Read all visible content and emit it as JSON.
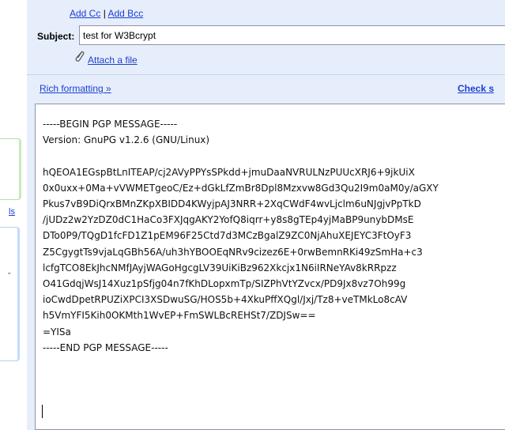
{
  "compose": {
    "add_cc": "Add Cc",
    "separator": "|",
    "add_bcc": "Add Bcc",
    "subject_label": "Subject:",
    "subject_value": "test for W3Bcrypt",
    "attach_label": "Attach a file",
    "rich_formatting": "Rich formatting »",
    "check_spelling": "Check s"
  },
  "sidebar": {
    "partial_link": "ls",
    "partial_mark": "ˇ"
  },
  "message": {
    "body": "-----BEGIN PGP MESSAGE-----\nVersion: GnuPG v1.2.6 (GNU/Linux)\n\nhQEOA1EGspBtLnITEAP/cj2AVyPPYsSPkdd+jmuDaaNVRULNzPUUcXRJ6+9jkUiX\n0x0uxx+0Ma+vVWMETgeoC/Ez+dGkLfZmBr8Dpl8Mzxvw8Gd3Qu2I9m0aM0y/aGXY\nPkus7vB9DiQrxBMnZKpXBIDD4KWyjpAJ3NRR+2XqCWdF4wvLjclm6uNJgjvPpTkD\n/jUDz2w2YzDZ0dC1HaCo3FXJqgAKY2YofQ8iqrr+y8s8gTEp4yjMaBP9unybDMsE\nDTo0P9/TQgD1fcFD1Z1pEM96F25Ctd7d3MCzBgalZ9ZC0NjAhuXEJEYC3FtOyF3\nZ5CgygtTs9vjaLqGBh56A/uh3hYBOOEqNRv9cizez6E+0rwBemnRKi49zSmHa+c3\nlcfgTCO8EkJhcNMfJAyjWAGoHgcgLV39UiKiBz962Xkcjx1N6iIRNeYAv8kRRpzz\nO41GdqjWsJ14Xuz1pSfjg04n7fKhDLopxmTp/SIZPhVtYZvcx/PD9Jx8vz7Oh99g\nioCwdDpetRPUZiXPCI3XSDwuSG/HOS5b+4XkuPffXQgl/Jxj/Tz8+veTMkLo8cAV\nh5VmYFI5Kih0OKMth1WvEP+FmSWLBcREHSt7/ZDJSw==\n=YISa\n-----END PGP MESSAGE-----"
  }
}
